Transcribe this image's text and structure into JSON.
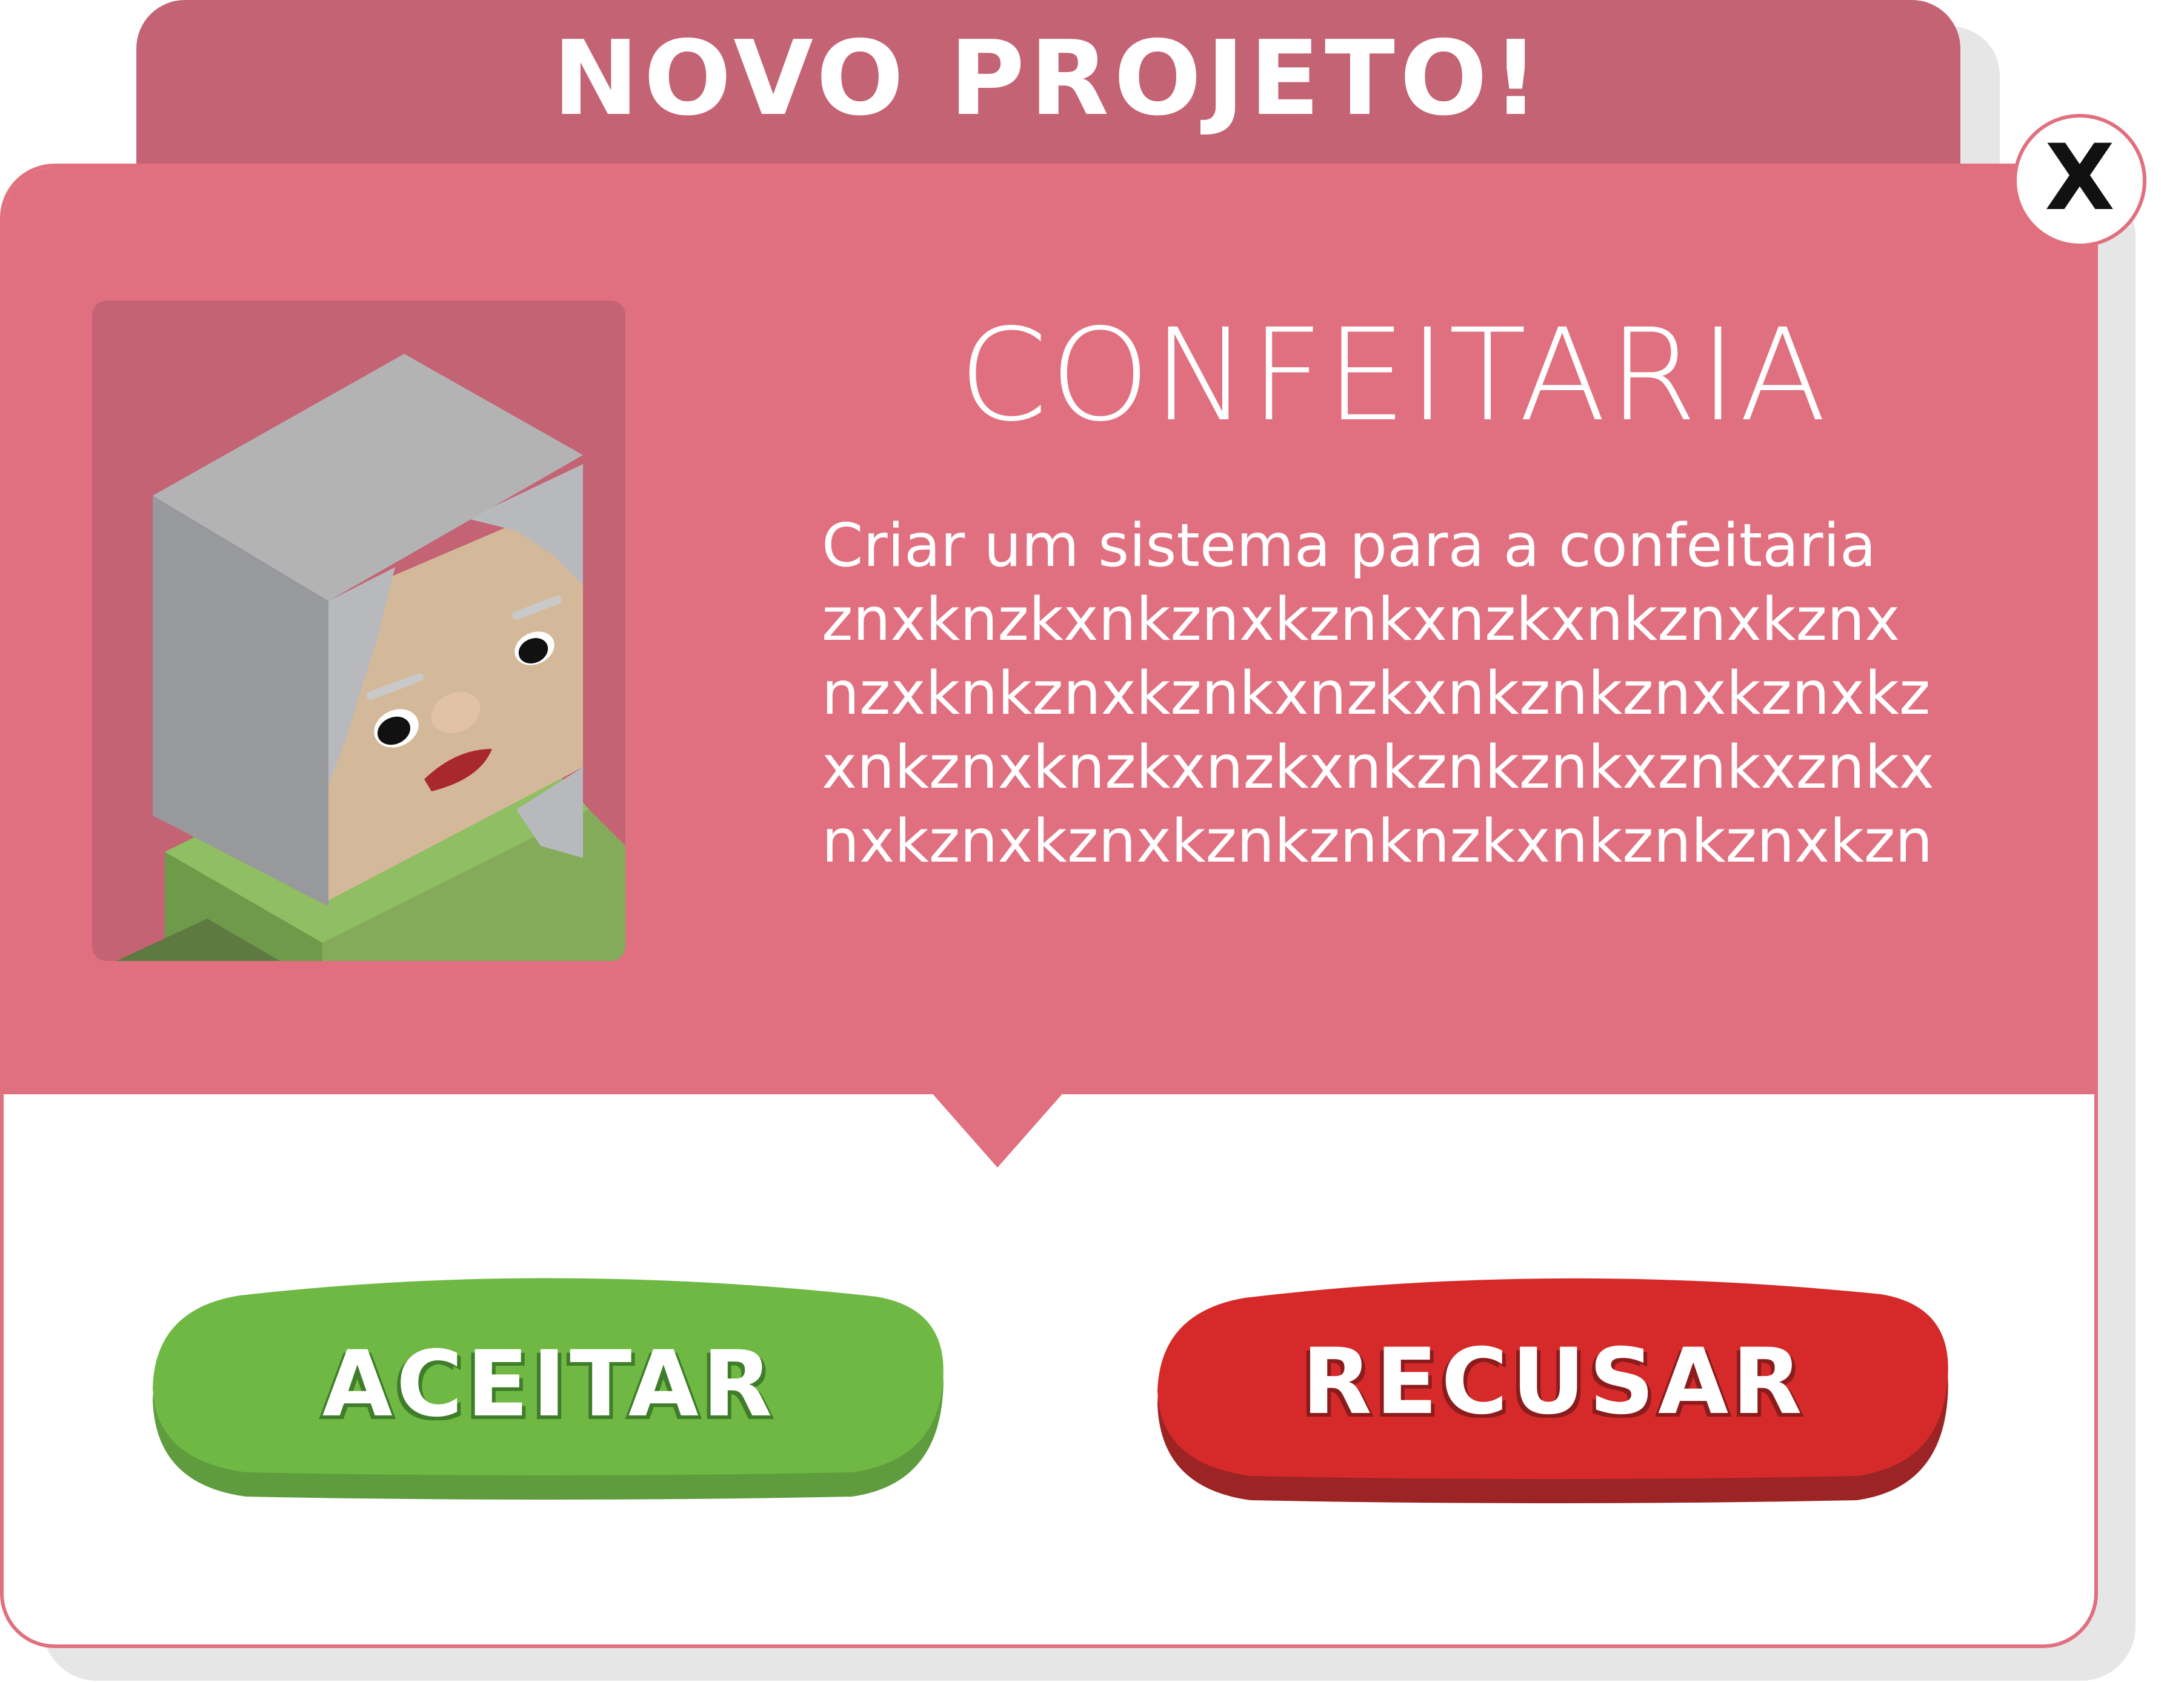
{
  "dialog": {
    "title": "NOVO PROJETO!",
    "close_label": "X"
  },
  "project": {
    "name": "CONFEITARIA",
    "description_lines": [
      "Criar um sistema para a confeitaria",
      "znxknzkxnkznxkznkxnzkxnkznxkznx",
      "nzxknkznxkznkxnzkxnkznkznxkznxkz",
      "xnkznxknzkxnzkxnkznkznkxznkxznkx",
      "nxkznxkznxkznkznknzkxnkznkznxkzn"
    ]
  },
  "actions": {
    "accept_label": "ACEITAR",
    "refuse_label": "RECUSAR"
  },
  "colors": {
    "header_tab": "#c46373",
    "card_top": "#e07080",
    "accept": "#6fb843",
    "refuse": "#d62a2a"
  },
  "icons": {
    "close": "close-icon",
    "avatar": "client-avatar"
  }
}
